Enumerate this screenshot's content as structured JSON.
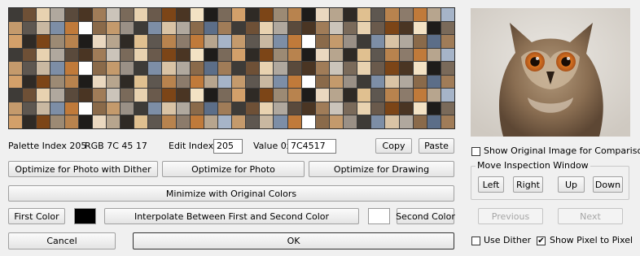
{
  "palette": {
    "rows": 9,
    "cols": 32,
    "seed_colors": [
      "#3e3b37",
      "#5a4a3c",
      "#7a6a5a",
      "#9c8a74",
      "#b7a58e",
      "#c9b8a1",
      "#8a6a4a",
      "#6e5036",
      "#4a3523",
      "#d3a06a",
      "#b8834e",
      "#a6b4c8",
      "#7d8ea6",
      "#5c6e88",
      "#e8d2b0",
      "#f3e2c4",
      "#2f2a25",
      "#8c7b6b",
      "#c49a6c",
      "#d9c3a5",
      "#a07c58",
      "#6a5a4c",
      "#1e1c1a",
      "#e0c090",
      "#c07a3a",
      "#9a9086",
      "#b0a89e",
      "#cbc4ba",
      "#7c4517",
      "#ead8c0",
      "#5e5750",
      "#ffffff"
    ]
  },
  "status": {
    "palette_index_label": "Palette Index 205",
    "rgb_label": "RGB 7C 45 17",
    "edit_index_label": "Edit Index",
    "edit_index_value": "205",
    "value_label": "Value 0x",
    "value_hex": "7C4517"
  },
  "buttons": {
    "copy": "Copy",
    "paste": "Paste",
    "optimize_photo_dither": "Optimize for Photo with Dither",
    "optimize_photo": "Optimize for Photo",
    "optimize_drawing": "Optimize for Drawing",
    "minimize_original": "Minimize with Original Colors",
    "first_color": "First Color",
    "interpolate": "Interpolate Between First and Second Color",
    "second_color": "Second Color",
    "cancel": "Cancel",
    "ok": "OK",
    "previous": "Previous",
    "next": "Next",
    "left": "Left",
    "right": "Right",
    "up": "Up",
    "down": "Down"
  },
  "colors": {
    "first_color": "#000000",
    "second_color": "#ffffff"
  },
  "right_panel": {
    "show_original_label": "Show Original Image for Comparison",
    "show_original_checked": false,
    "move_group_title": "Move Inspection Window",
    "use_dither_label": "Use Dither",
    "use_dither_checked": false,
    "show_pixel_label": "Show Pixel to Pixel",
    "show_pixel_checked": true
  }
}
